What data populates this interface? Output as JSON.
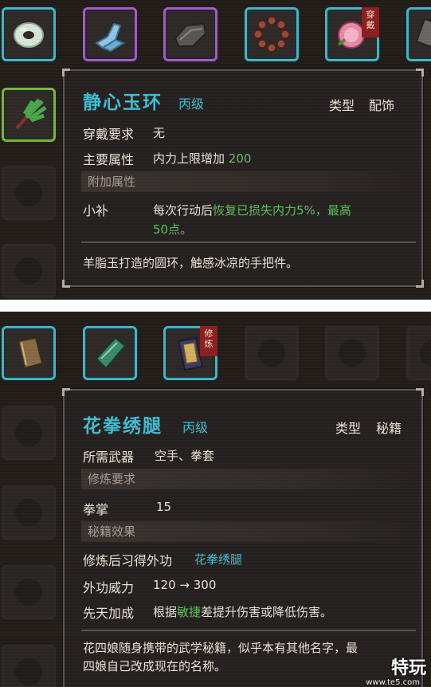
{
  "panel1": {
    "tag_wear": [
      "穿",
      "戴"
    ],
    "tooltip": {
      "title": "静心玉环",
      "grade": "丙级",
      "type_label": "类型",
      "type_value": "配饰",
      "req_label": "穿戴要求",
      "req_value": "无",
      "main_attr_label": "主要属性",
      "main_attr_value": "内力上限增加",
      "main_attr_amount": "200",
      "extra_section": "附加属性",
      "extra_name": "小补",
      "extra_desc_a": "每次行动后",
      "extra_desc_b": "恢复已损失内力5%，最高",
      "extra_desc_c": "50点。",
      "desc": "羊脂玉打造的圆环，触感冰凉的手把件。"
    }
  },
  "panel2": {
    "tag_practice": [
      "修",
      "炼"
    ],
    "tooltip": {
      "title": "花拳绣腿",
      "grade": "丙级",
      "type_label": "类型",
      "type_value": "秘籍",
      "weapon_label": "所需武器",
      "weapon_value": "空手、拳套",
      "practice_section": "修炼要求",
      "fist_label": "拳掌",
      "fist_value": "15",
      "effect_section": "秘籍效果",
      "learn_label": "修炼后习得外功",
      "learn_value": "花拳绣腿",
      "power_label": "外功威力",
      "power_value": "120 → 300",
      "innate_label": "先天加成",
      "innate_a": "根据",
      "innate_b": "敏捷",
      "innate_c": "差提升伤害或降低伤害。",
      "desc_1": "花四娘随身携带的武学秘籍，似乎本有其他名字，最",
      "desc_2": "四娘自己改成现在的名称。"
    }
  },
  "watermark": {
    "main": "特玩",
    "sub": "www.te5.com"
  },
  "colors": {
    "cyan": "#3ec0d6",
    "green": "#5cc25c",
    "purple": "#a45cc8",
    "tag_red": "#8c1f1f"
  }
}
